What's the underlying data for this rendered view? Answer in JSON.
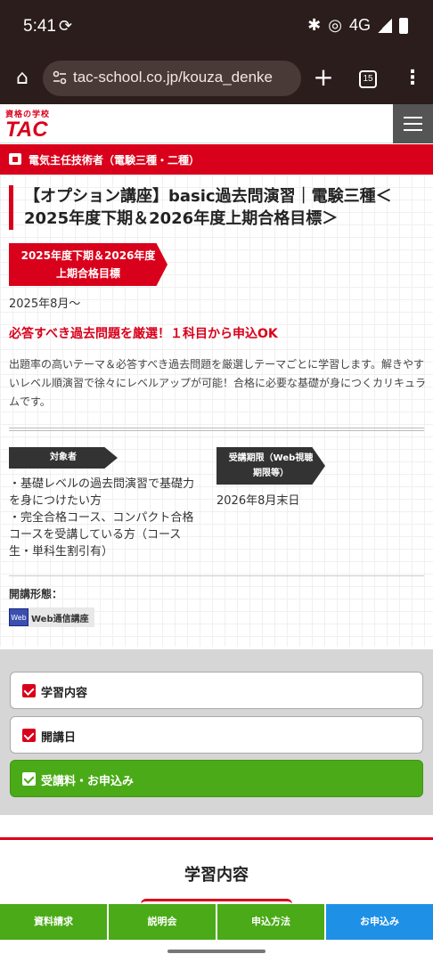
{
  "status_bar": {
    "time": "5:41",
    "network": "4G"
  },
  "browser": {
    "url": "tac-school.co.jp/kouza_denke",
    "tab_count": "15"
  },
  "header": {
    "logo_small": "資格の学校",
    "logo_big": "TAC"
  },
  "category": {
    "label": "電気主任技術者（電験三種・二種）"
  },
  "course": {
    "title": "【オプション講座】basic過去問演習｜電験三種＜2025年度下期＆2026年度上期合格目標＞",
    "ribbon_line1": "2025年度下期＆2026年度",
    "ribbon_line2": "上期合格目標",
    "start_date": "2025年8月〜",
    "catch": "必答すべき過去問題を厳選！１科目から申込OK",
    "description": "出題率の高いテーマ＆必答すべき過去問題を厳選しテーマごとに学習します。解きやすいレベル順演習で徐々にレベルアップが可能！合格に必要な基礎が身につくカリキュラムです。"
  },
  "details": {
    "target_tag": "対象者",
    "target_line1": "・基礎レベルの過去問演習で基礎力を身につけたい方",
    "target_line2": "・完全合格コース、コンパクト合格コースを受講している方（コース生・単科生割引有）",
    "period_tag_line1": "受講期限（Web視聴",
    "period_tag_line2": "期限等）",
    "period_value": "2026年8月末日",
    "format_label": "開講形態：",
    "format_badge": "Web通信講座",
    "format_icon_text": "Web"
  },
  "accordion": [
    {
      "label": "学習内容"
    },
    {
      "label": "開講日"
    },
    {
      "label": "受講料・お申込み"
    }
  ],
  "section": {
    "title": "学習内容"
  },
  "bottom_nav": [
    {
      "label": "資料請求"
    },
    {
      "label": "説明会"
    },
    {
      "label": "申込方法"
    },
    {
      "label": "お申込み"
    }
  ],
  "colors": {
    "brand_red": "#d9001b",
    "green": "#4aaa17",
    "blue": "#1e90e6"
  }
}
